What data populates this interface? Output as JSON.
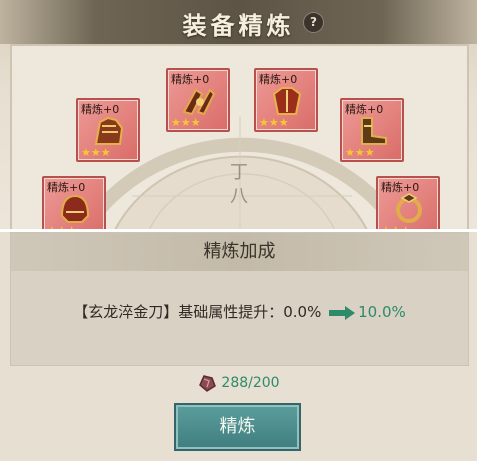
{
  "header": {
    "title": "装备精炼",
    "help_glyph": "?"
  },
  "dial": {
    "chars": [
      "丁",
      "八"
    ]
  },
  "slots": [
    {
      "refine": "精炼+0",
      "stars": "★★★",
      "icon": "gauntlet-icon",
      "color": "#b8504c"
    },
    {
      "refine": "精炼+0",
      "stars": "★★★",
      "icon": "claw-weapon-icon",
      "color": "#b8504c"
    },
    {
      "refine": "精炼+0",
      "stars": "★★★",
      "icon": "armor-icon",
      "color": "#b8504c"
    },
    {
      "refine": "精炼+0",
      "stars": "★★★",
      "icon": "boots-icon",
      "color": "#b8504c"
    },
    {
      "refine": "精炼+0",
      "stars": "★★★",
      "icon": "helmet-icon",
      "color": "#b8504c"
    },
    {
      "refine": "精炼+0",
      "stars": "★★★",
      "icon": "ring-icon",
      "color": "#b8504c"
    }
  ],
  "bonus": {
    "heading": "精炼加成",
    "item": "【玄龙淬金刀】",
    "attr": "基础属性提升：",
    "current": "0.0%",
    "next": "10.0%"
  },
  "cost": {
    "amount": "288/200",
    "icon": "ore-icon"
  },
  "button": {
    "label": "精炼"
  },
  "colors": {
    "accent": "#2f8a6a",
    "button": "#417f80",
    "slot": "#e27f7b"
  }
}
